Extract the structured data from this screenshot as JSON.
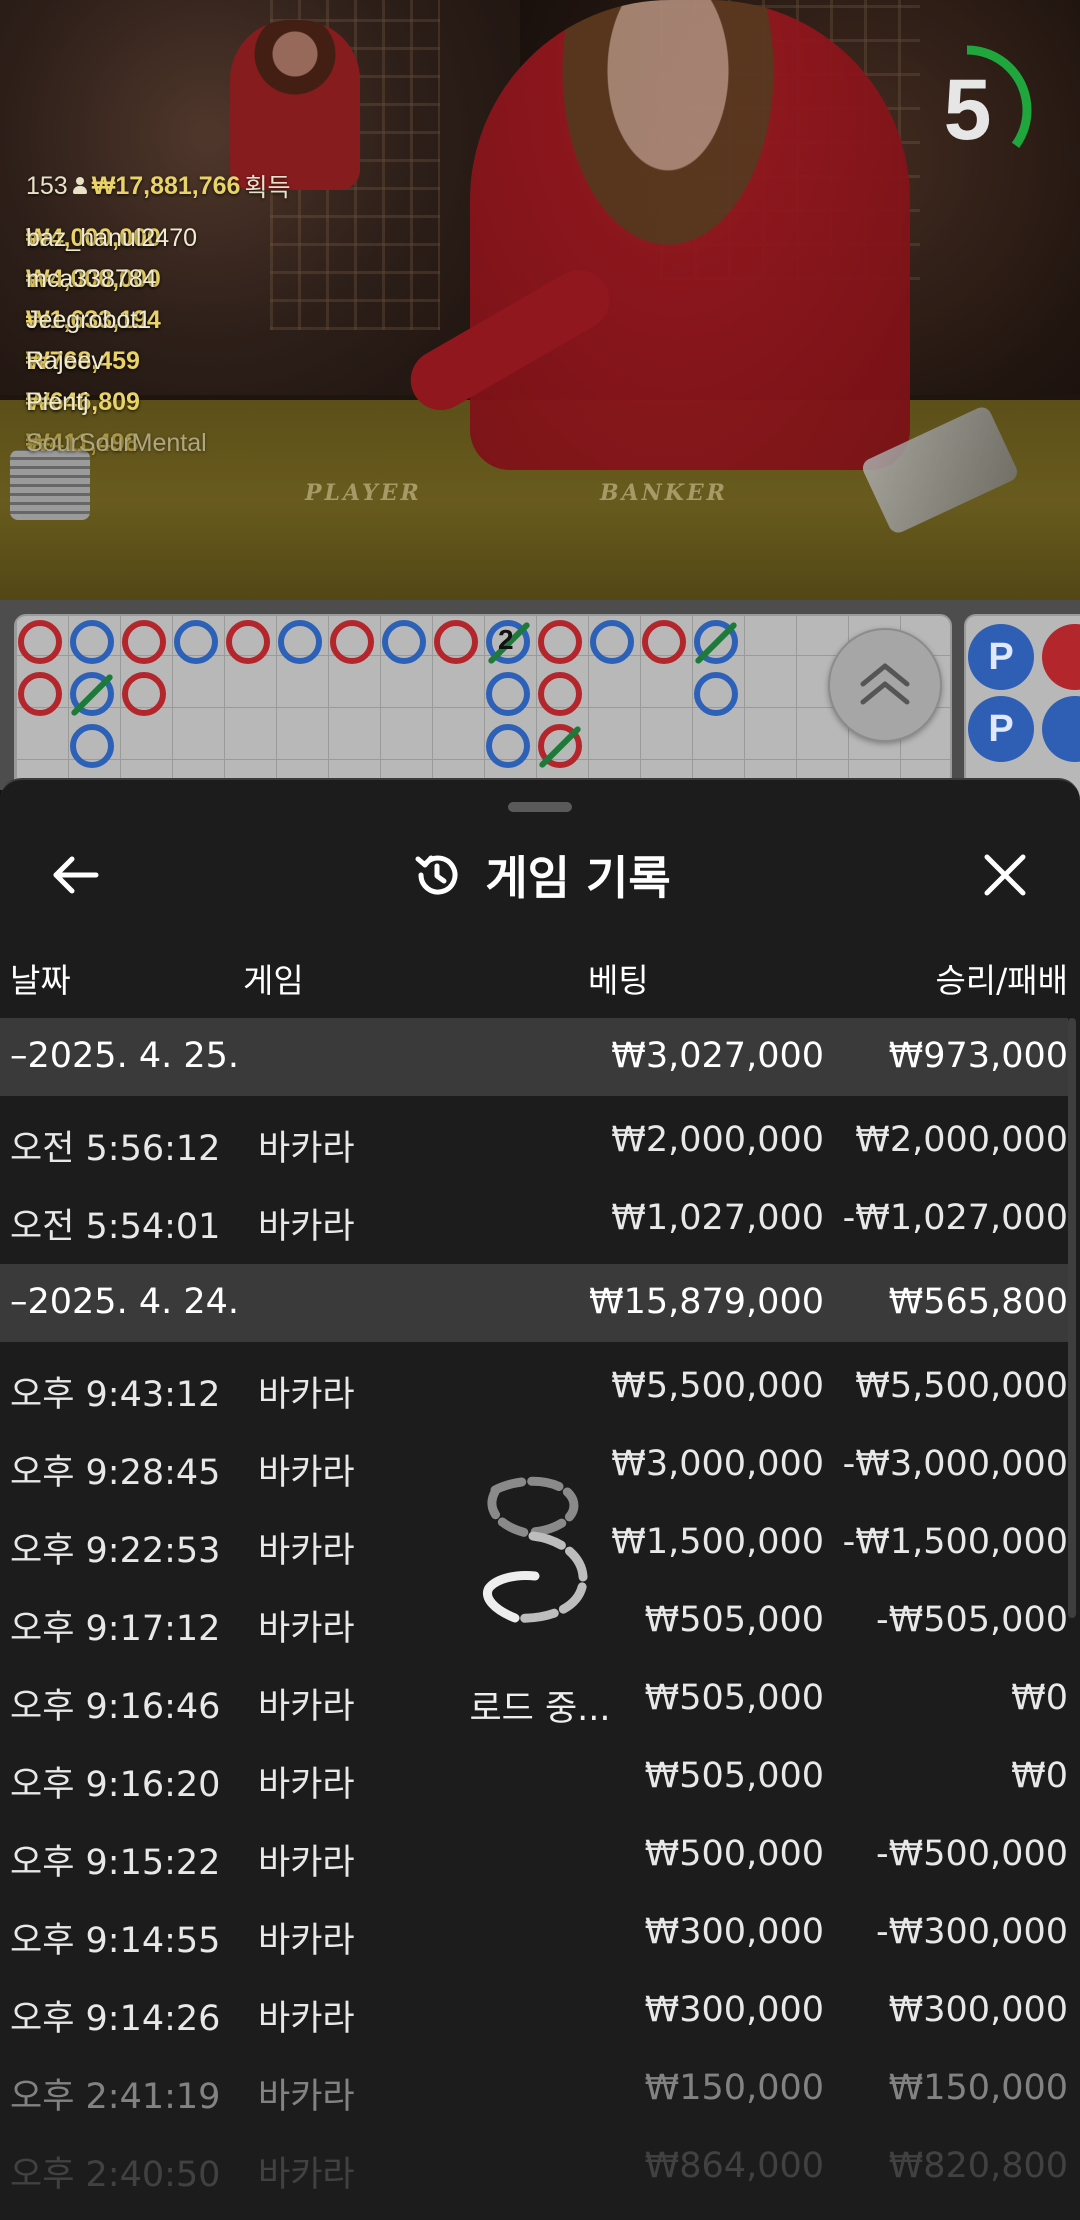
{
  "video": {
    "table_player": "PLAYER",
    "table_banker": "BANKER",
    "timer": "5",
    "timer_fraction": 0.35,
    "winners_total": {
      "count": "153",
      "amount": "₩17,881,766",
      "suffix": "획득"
    },
    "winners": [
      {
        "amount": "₩4,000,000",
        "user": "baz_hanul2470"
      },
      {
        "amount": "₩4,000,000",
        "user": "mca338784"
      },
      {
        "amount": "₩1,633,194",
        "user": "Jeegrobot1"
      },
      {
        "amount": "₩768,459",
        "user": "Rajeev"
      },
      {
        "amount": "₩646,809",
        "user": "Pientj"
      },
      {
        "amount": "₩411,498",
        "user": "SourSourMental"
      }
    ]
  },
  "roadmap": {
    "tie_count": "2",
    "player_mark": "P"
  },
  "panel": {
    "title": "게임 기록",
    "columns": {
      "date": "날짜",
      "game": "게임",
      "bet": "베팅",
      "result": "승리/패배"
    },
    "loading_text": "로드 중...",
    "groups": [
      {
        "date": "–2025. 4. 25.",
        "bet": "₩3,027,000",
        "result": "₩973,000",
        "rows": [
          {
            "time": "오전 5:56:12",
            "game": "바카라",
            "bet": "₩2,000,000",
            "result": "₩2,000,000"
          },
          {
            "time": "오전 5:54:01",
            "game": "바카라",
            "bet": "₩1,027,000",
            "result": "-₩1,027,000"
          }
        ]
      },
      {
        "date": "–2025. 4. 24.",
        "bet": "₩15,879,000",
        "result": "₩565,800",
        "rows": [
          {
            "time": "오후 9:43:12",
            "game": "바카라",
            "bet": "₩5,500,000",
            "result": "₩5,500,000"
          },
          {
            "time": "오후 9:28:45",
            "game": "바카라",
            "bet": "₩3,000,000",
            "result": "-₩3,000,000"
          },
          {
            "time": "오후 9:22:53",
            "game": "바카라",
            "bet": "₩1,500,000",
            "result": "-₩1,500,000"
          },
          {
            "time": "오후 9:17:12",
            "game": "바카라",
            "bet": "₩505,000",
            "result": "-₩505,000"
          },
          {
            "time": "오후 9:16:46",
            "game": "바카라",
            "bet": "₩505,000",
            "result": "₩0"
          },
          {
            "time": "오후 9:16:20",
            "game": "바카라",
            "bet": "₩505,000",
            "result": "₩0"
          },
          {
            "time": "오후 9:15:22",
            "game": "바카라",
            "bet": "₩500,000",
            "result": "-₩500,000"
          },
          {
            "time": "오후 9:14:55",
            "game": "바카라",
            "bet": "₩300,000",
            "result": "-₩300,000"
          },
          {
            "time": "오후 9:14:26",
            "game": "바카라",
            "bet": "₩300,000",
            "result": "₩300,000"
          },
          {
            "time": "오후 2:41:19",
            "game": "바카라",
            "bet": "₩150,000",
            "result": "₩150,000"
          },
          {
            "time": "오후 2:40:50",
            "game": "바카라",
            "bet": "₩864,000",
            "result": "₩820,800"
          }
        ]
      }
    ]
  },
  "colors": {
    "panel_bg": "#1c1c1c",
    "group_bg": "#3a3a3a",
    "timer_green": "#1fa63c",
    "banker_red": "#b3262c",
    "player_blue": "#2d61b8",
    "winner_gold": "#e9d266"
  }
}
